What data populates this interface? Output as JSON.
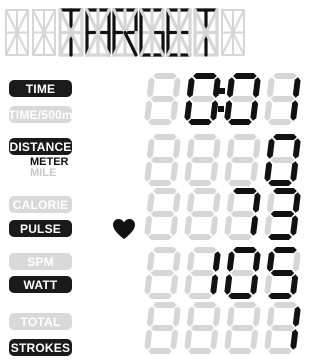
{
  "colors": {
    "segment_on": "#111111",
    "segment_off": "#d6d6d6",
    "label_on_bg": "#1a1a1a",
    "label_off_bg": "#d9d9d9"
  },
  "banner": {
    "text": "TARGET",
    "lit_start": 2
  },
  "labels": [
    {
      "id": "time",
      "text": "TIME",
      "active": true
    },
    {
      "id": "time500",
      "text": "TIME/500m",
      "active": false
    },
    {
      "id": "distance",
      "text": "DISTANCE",
      "active": true
    },
    {
      "id": "calorie",
      "text": "CALORIE",
      "active": false
    },
    {
      "id": "pulse",
      "text": "PULSE",
      "active": true
    },
    {
      "id": "spm",
      "text": "SPM",
      "active": false
    },
    {
      "id": "watt",
      "text": "WATT",
      "active": true
    },
    {
      "id": "total",
      "text": "TOTAL",
      "active": false
    },
    {
      "id": "strokes",
      "text": "STROKES",
      "active": true
    }
  ],
  "units": {
    "meter": "METER",
    "mile": "MILE"
  },
  "heart_icon": "heart-icon",
  "rows": [
    {
      "id": "time",
      "value": "0:01"
    },
    {
      "id": "distance",
      "value": "0"
    },
    {
      "id": "pulse",
      "value": "73"
    },
    {
      "id": "watt",
      "value": "105"
    },
    {
      "id": "strokes",
      "value": "1"
    }
  ]
}
